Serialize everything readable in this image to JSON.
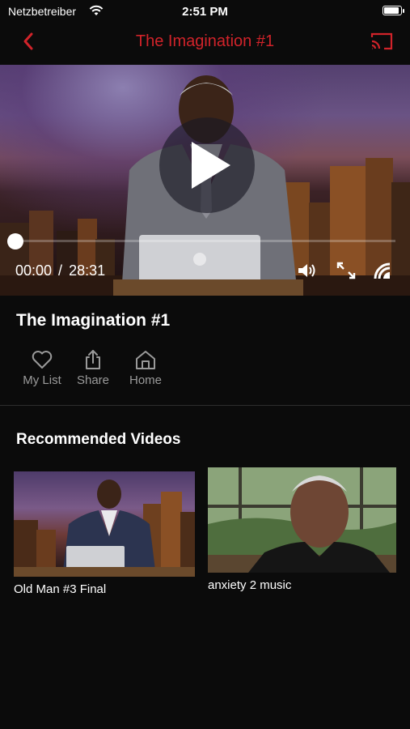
{
  "status_bar": {
    "carrier": "Netzbetreiber",
    "time": "2:51 PM",
    "battery_level": 1.0
  },
  "nav": {
    "title": "The Imagination #1",
    "accent_color": "#d1232a"
  },
  "player": {
    "current_time": "00:00",
    "separator": "/",
    "duration": "28:31",
    "progress": 0
  },
  "video": {
    "title": "The Imagination #1"
  },
  "actions": [
    {
      "label": "My List",
      "icon": "heart-icon"
    },
    {
      "label": "Share",
      "icon": "share-icon"
    },
    {
      "label": "Home",
      "icon": "home-icon"
    }
  ],
  "recommended": {
    "heading": "Recommended Videos",
    "items": [
      {
        "title": "Old Man #3 Final"
      },
      {
        "title": "anxiety 2 music"
      }
    ]
  }
}
